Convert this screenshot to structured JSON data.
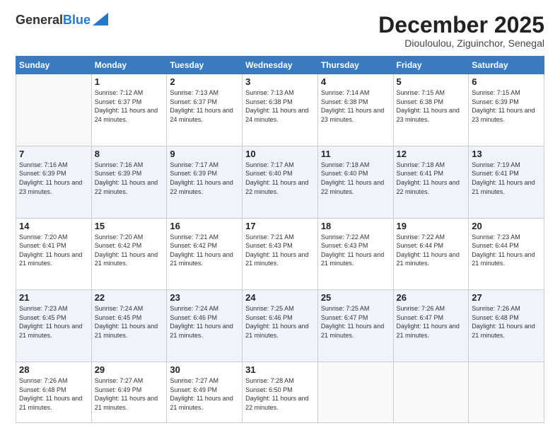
{
  "logo": {
    "general": "General",
    "blue": "Blue"
  },
  "header": {
    "title": "December 2025",
    "subtitle": "Diouloulou, Ziguinchor, Senegal"
  },
  "weekdays": [
    "Sunday",
    "Monday",
    "Tuesday",
    "Wednesday",
    "Thursday",
    "Friday",
    "Saturday"
  ],
  "weeks": [
    [
      {
        "day": "",
        "info": ""
      },
      {
        "day": "1",
        "info": "Sunrise: 7:12 AM\nSunset: 6:37 PM\nDaylight: 11 hours and 24 minutes."
      },
      {
        "day": "2",
        "info": "Sunrise: 7:13 AM\nSunset: 6:37 PM\nDaylight: 11 hours and 24 minutes."
      },
      {
        "day": "3",
        "info": "Sunrise: 7:13 AM\nSunset: 6:38 PM\nDaylight: 11 hours and 24 minutes."
      },
      {
        "day": "4",
        "info": "Sunrise: 7:14 AM\nSunset: 6:38 PM\nDaylight: 11 hours and 23 minutes."
      },
      {
        "day": "5",
        "info": "Sunrise: 7:15 AM\nSunset: 6:38 PM\nDaylight: 11 hours and 23 minutes."
      },
      {
        "day": "6",
        "info": "Sunrise: 7:15 AM\nSunset: 6:39 PM\nDaylight: 11 hours and 23 minutes."
      }
    ],
    [
      {
        "day": "7",
        "info": "Sunrise: 7:16 AM\nSunset: 6:39 PM\nDaylight: 11 hours and 23 minutes."
      },
      {
        "day": "8",
        "info": "Sunrise: 7:16 AM\nSunset: 6:39 PM\nDaylight: 11 hours and 22 minutes."
      },
      {
        "day": "9",
        "info": "Sunrise: 7:17 AM\nSunset: 6:39 PM\nDaylight: 11 hours and 22 minutes."
      },
      {
        "day": "10",
        "info": "Sunrise: 7:17 AM\nSunset: 6:40 PM\nDaylight: 11 hours and 22 minutes."
      },
      {
        "day": "11",
        "info": "Sunrise: 7:18 AM\nSunset: 6:40 PM\nDaylight: 11 hours and 22 minutes."
      },
      {
        "day": "12",
        "info": "Sunrise: 7:18 AM\nSunset: 6:41 PM\nDaylight: 11 hours and 22 minutes."
      },
      {
        "day": "13",
        "info": "Sunrise: 7:19 AM\nSunset: 6:41 PM\nDaylight: 11 hours and 21 minutes."
      }
    ],
    [
      {
        "day": "14",
        "info": "Sunrise: 7:20 AM\nSunset: 6:41 PM\nDaylight: 11 hours and 21 minutes."
      },
      {
        "day": "15",
        "info": "Sunrise: 7:20 AM\nSunset: 6:42 PM\nDaylight: 11 hours and 21 minutes."
      },
      {
        "day": "16",
        "info": "Sunrise: 7:21 AM\nSunset: 6:42 PM\nDaylight: 11 hours and 21 minutes."
      },
      {
        "day": "17",
        "info": "Sunrise: 7:21 AM\nSunset: 6:43 PM\nDaylight: 11 hours and 21 minutes."
      },
      {
        "day": "18",
        "info": "Sunrise: 7:22 AM\nSunset: 6:43 PM\nDaylight: 11 hours and 21 minutes."
      },
      {
        "day": "19",
        "info": "Sunrise: 7:22 AM\nSunset: 6:44 PM\nDaylight: 11 hours and 21 minutes."
      },
      {
        "day": "20",
        "info": "Sunrise: 7:23 AM\nSunset: 6:44 PM\nDaylight: 11 hours and 21 minutes."
      }
    ],
    [
      {
        "day": "21",
        "info": "Sunrise: 7:23 AM\nSunset: 6:45 PM\nDaylight: 11 hours and 21 minutes."
      },
      {
        "day": "22",
        "info": "Sunrise: 7:24 AM\nSunset: 6:45 PM\nDaylight: 11 hours and 21 minutes."
      },
      {
        "day": "23",
        "info": "Sunrise: 7:24 AM\nSunset: 6:46 PM\nDaylight: 11 hours and 21 minutes."
      },
      {
        "day": "24",
        "info": "Sunrise: 7:25 AM\nSunset: 6:46 PM\nDaylight: 11 hours and 21 minutes."
      },
      {
        "day": "25",
        "info": "Sunrise: 7:25 AM\nSunset: 6:47 PM\nDaylight: 11 hours and 21 minutes."
      },
      {
        "day": "26",
        "info": "Sunrise: 7:26 AM\nSunset: 6:47 PM\nDaylight: 11 hours and 21 minutes."
      },
      {
        "day": "27",
        "info": "Sunrise: 7:26 AM\nSunset: 6:48 PM\nDaylight: 11 hours and 21 minutes."
      }
    ],
    [
      {
        "day": "28",
        "info": "Sunrise: 7:26 AM\nSunset: 6:48 PM\nDaylight: 11 hours and 21 minutes."
      },
      {
        "day": "29",
        "info": "Sunrise: 7:27 AM\nSunset: 6:49 PM\nDaylight: 11 hours and 21 minutes."
      },
      {
        "day": "30",
        "info": "Sunrise: 7:27 AM\nSunset: 6:49 PM\nDaylight: 11 hours and 21 minutes."
      },
      {
        "day": "31",
        "info": "Sunrise: 7:28 AM\nSunset: 6:50 PM\nDaylight: 11 hours and 22 minutes."
      },
      {
        "day": "",
        "info": ""
      },
      {
        "day": "",
        "info": ""
      },
      {
        "day": "",
        "info": ""
      }
    ]
  ]
}
